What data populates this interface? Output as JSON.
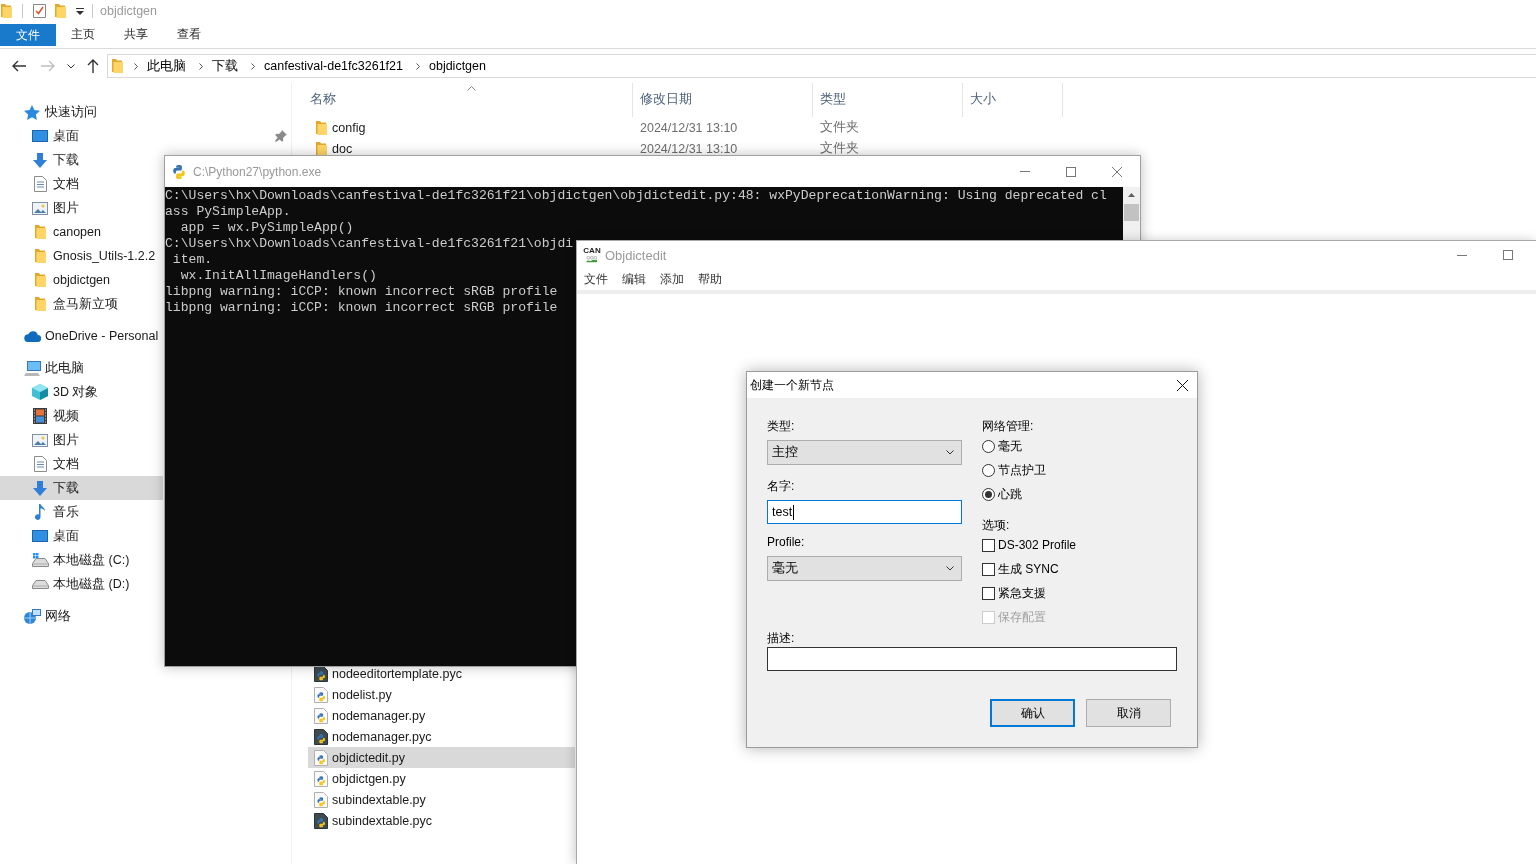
{
  "explorer": {
    "title": "objdictgen",
    "ribbon_tabs": [
      {
        "label": "文件",
        "kind": "file_menu"
      },
      {
        "label": "主页",
        "kind": "tab"
      },
      {
        "label": "共享",
        "kind": "tab"
      },
      {
        "label": "查看",
        "kind": "tab"
      }
    ],
    "address_bar": {
      "forward_disabled": true,
      "breadcrumbs": [
        "此电脑",
        "下载",
        "canfestival-de1fc3261f21",
        "objdictgen"
      ]
    },
    "nav_pane": [
      {
        "label": "快速访问",
        "kind": "star",
        "selected": false,
        "children": [
          {
            "label": "桌面",
            "kind": "desktop",
            "pinned": true,
            "selected": false
          },
          {
            "label": "下载",
            "kind": "download",
            "pinned": false,
            "selected": false
          },
          {
            "label": "文档",
            "kind": "document",
            "pinned": false,
            "selected": false
          },
          {
            "label": "图片",
            "kind": "pictures",
            "pinned": false,
            "selected": false
          },
          {
            "label": "canopen",
            "kind": "folder",
            "pinned": false,
            "selected": false
          },
          {
            "label": "Gnosis_Utils-1.2.2",
            "kind": "folder",
            "pinned": false,
            "selected": false
          },
          {
            "label": "objdictgen",
            "kind": "folder",
            "pinned": false,
            "selected": false
          },
          {
            "label": "盒马新立项",
            "kind": "folder",
            "pinned": false,
            "selected": false
          }
        ]
      },
      {
        "label": "OneDrive - Personal",
        "kind": "cloud",
        "selected": false
      },
      {
        "label": "此电脑",
        "kind": "computer",
        "selected": false,
        "children": [
          {
            "label": "3D 对象",
            "kind": "cube",
            "selected": false
          },
          {
            "label": "视频",
            "kind": "video",
            "selected": false
          },
          {
            "label": "图片",
            "kind": "pictures",
            "selected": false
          },
          {
            "label": "文档",
            "kind": "document",
            "selected": false
          },
          {
            "label": "下载",
            "kind": "download",
            "selected": true
          },
          {
            "label": "音乐",
            "kind": "music",
            "selected": false
          },
          {
            "label": "桌面",
            "kind": "desktop",
            "selected": false
          },
          {
            "label": "本地磁盘 (C:)",
            "kind": "system_drive",
            "selected": false
          },
          {
            "label": "本地磁盘 (D:)",
            "kind": "drive",
            "selected": false
          }
        ]
      },
      {
        "label": "网络",
        "kind": "network",
        "selected": false
      }
    ],
    "file_list": {
      "columns": [
        {
          "label": "名称",
          "sorted": true
        },
        {
          "label": "修改日期",
          "sorted": false
        },
        {
          "label": "类型",
          "sorted": false
        },
        {
          "label": "大小",
          "sorted": false
        }
      ],
      "top_rows": [
        {
          "name": "config",
          "kind": "folder",
          "modified": "2024/12/31 13:10",
          "type": "文件夹",
          "selected": false
        },
        {
          "name": "doc",
          "kind": "folder",
          "modified": "2024/12/31 13:10",
          "type": "文件夹",
          "selected": false
        }
      ],
      "bottom_rows": [
        {
          "name": "nodeeditortemplate.pyc",
          "kind": "pyc",
          "selected": false
        },
        {
          "name": "nodelist.py",
          "kind": "py",
          "selected": false
        },
        {
          "name": "nodemanager.py",
          "kind": "py",
          "selected": false
        },
        {
          "name": "nodemanager.pyc",
          "kind": "pyc",
          "selected": false
        },
        {
          "name": "objdictedit.py",
          "kind": "py",
          "selected": true
        },
        {
          "name": "objdictgen.py",
          "kind": "py",
          "selected": false
        },
        {
          "name": "subindextable.py",
          "kind": "py",
          "selected": false
        },
        {
          "name": "subindextable.pyc",
          "kind": "pyc",
          "selected": false
        }
      ]
    }
  },
  "console_window": {
    "title": "C:\\Python27\\python.exe",
    "lines": [
      "C:\\Users\\hx\\Downloads\\canfestival-de1fc3261f21\\objdictgen\\objdictedit.py:48: wxPyDeprecationWarning: Using deprecated cl",
      "ass PySimpleApp.",
      "  app = wx.PySimpleApp()",
      "C:\\Users\\hx\\Downloads\\canfestival-de1fc3261f21\\objdi",
      " item.",
      "  wx.InitAllImageHandlers()",
      "libpng warning: iCCP: known incorrect sRGB profile",
      "libpng warning: iCCP: known incorrect sRGB profile"
    ]
  },
  "objdictedit_window": {
    "title": "Objdictedit",
    "logo_text": "CAN",
    "menu": [
      "文件",
      "编辑",
      "添加",
      "帮助"
    ]
  },
  "new_node_dialog": {
    "title": "创建一个新节点",
    "type_label": "类型:",
    "type_value": "主控",
    "name_label": "名字:",
    "name_value": "test",
    "name_focused": true,
    "profile_label": "Profile:",
    "profile_value": "毫无",
    "network_label": "网络管理:",
    "network_options": [
      {
        "label": "毫无",
        "selected": false
      },
      {
        "label": "节点护卫",
        "selected": false
      },
      {
        "label": "心跳",
        "selected": true
      }
    ],
    "options_label": "选项:",
    "options": [
      {
        "label": "DS-302 Profile",
        "checked": false,
        "disabled": false
      },
      {
        "label": "生成 SYNC",
        "checked": false,
        "disabled": false
      },
      {
        "label": "紧急支援",
        "checked": false,
        "disabled": false
      },
      {
        "label": "保存配置",
        "checked": false,
        "disabled": true
      }
    ],
    "description_label": "描述:",
    "buttons": [
      {
        "label": "确认",
        "default": true
      },
      {
        "label": "取消",
        "default": false
      }
    ]
  }
}
